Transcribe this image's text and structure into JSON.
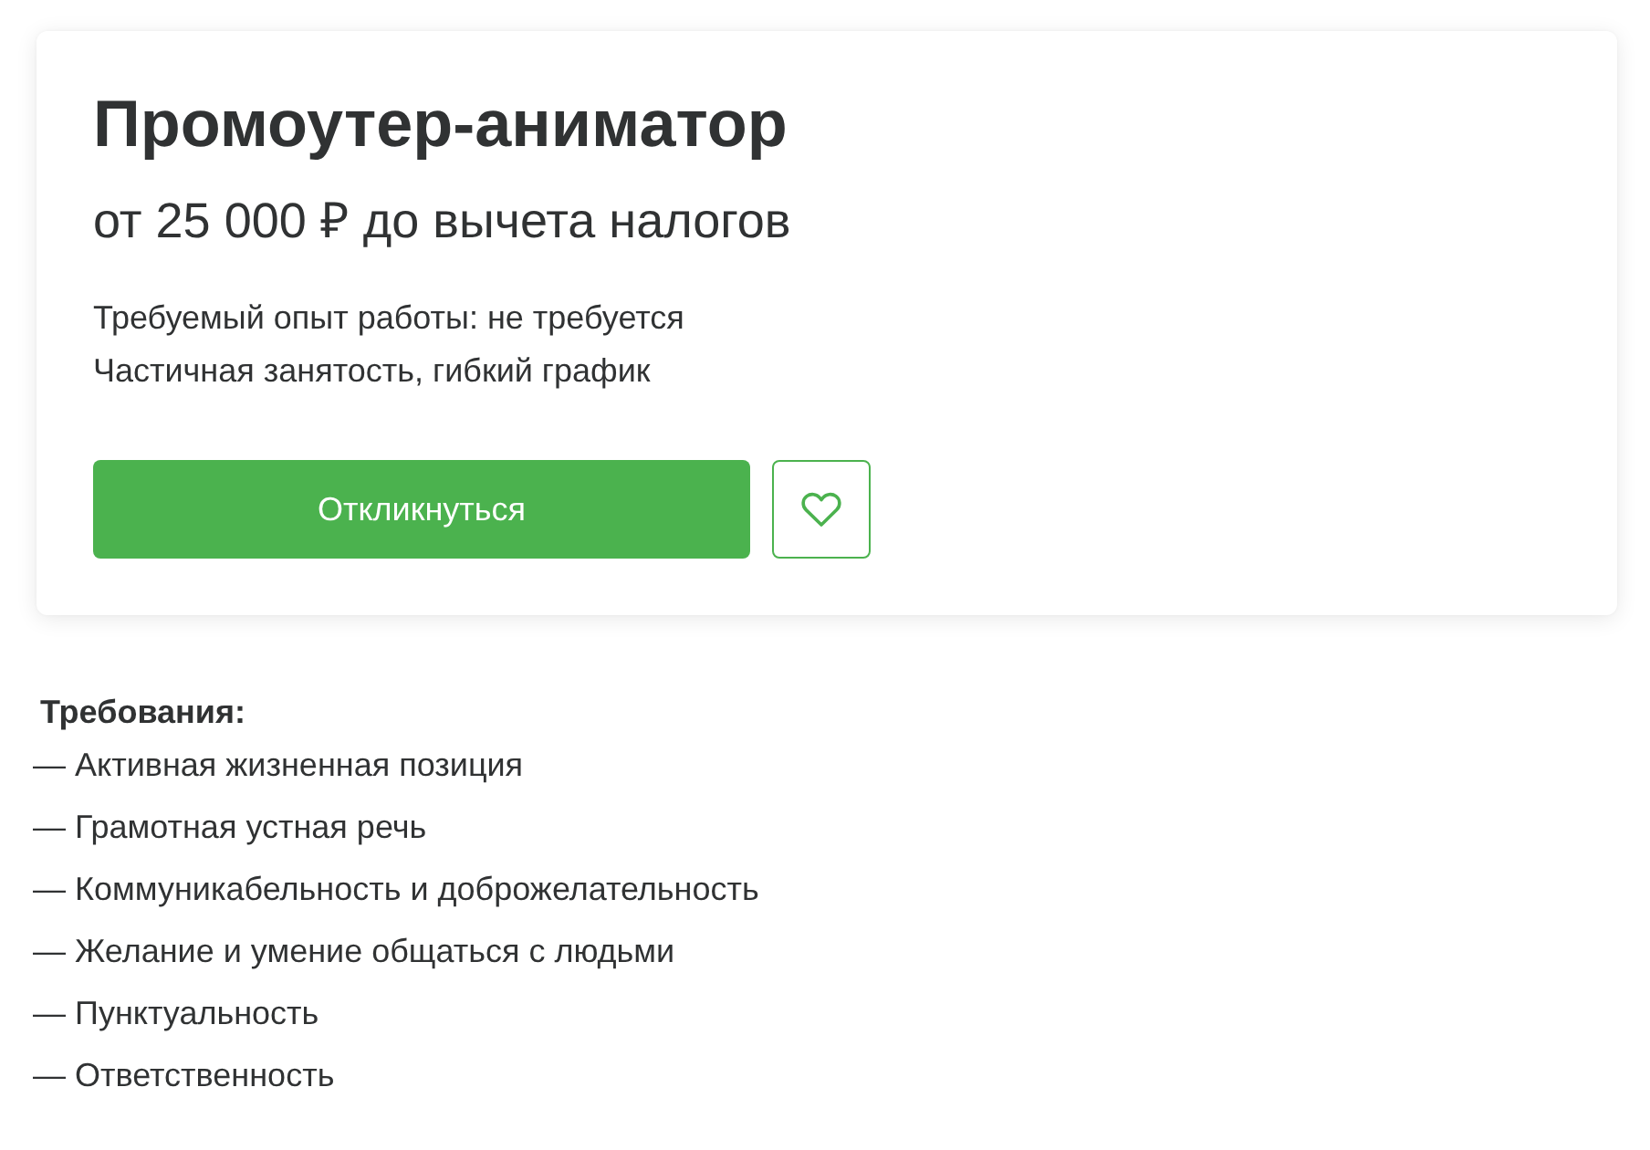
{
  "vacancy": {
    "title": "Промоутер-аниматор",
    "salary": "от 25 000 ₽ до вычета налогов",
    "details": [
      "Требуемый опыт работы: не требуется",
      "Частичная занятость, гибкий график"
    ],
    "respond_button": "Откликнуться",
    "favorite": {
      "saved": false
    }
  },
  "requirements": {
    "heading": "Требования:",
    "items": [
      "— Активная жизненная позиция",
      "— Грамотная устная речь",
      "— Коммуникабельность и доброжелательность",
      "— Желание и умение общаться с людьми",
      "— Пунктуальность",
      "— Ответственность"
    ]
  }
}
